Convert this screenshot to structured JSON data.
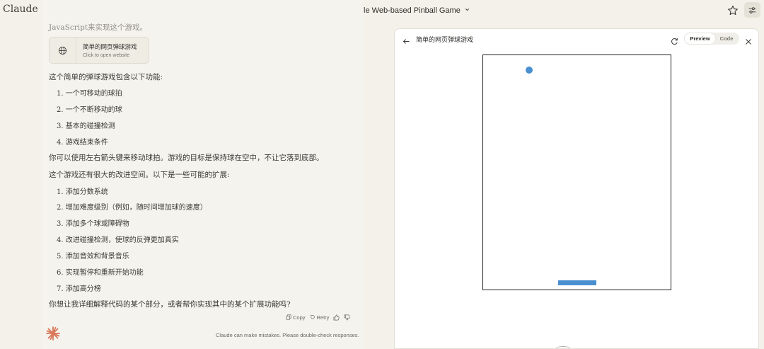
{
  "app": {
    "brand": "Claude"
  },
  "header": {
    "title": "Simple Web-based Pinball Game"
  },
  "chat": {
    "faded_line": "JavaScript来实现这个游戏。",
    "artifact_card": {
      "title": "简单的网页弹球游戏",
      "subtitle": "Click to open website"
    },
    "features_intro": "这个简单的弹球游戏包含以下功能:",
    "features": [
      "1. 一个可移动的球拍",
      "2. 一个不断移动的球",
      "3. 基本的碰撞检测",
      "4. 游戏结束条件"
    ],
    "controls_text": "你可以使用左右箭头键来移动球拍。游戏的目标是保持球在空中，不让它落到底部。",
    "extensions_intro": "这个游戏还有很大的改进空间。以下是一些可能的扩展:",
    "extensions": [
      "1. 添加分数系统",
      "2. 增加难度级别（例如，随时间增加球的速度）",
      "3. 添加多个球或障碍物",
      "4. 改进碰撞检测，使球的反弹更加真实",
      "5. 添加音效和背景音乐",
      "6. 实现暂停和重新开始功能",
      "7. 添加高分榜"
    ],
    "closing_question": "你想让我详细解释代码的某个部分，或者帮你实现其中的某个扩展功能吗?",
    "actions": {
      "copy": "Copy",
      "retry": "Retry"
    },
    "disclaimer": "Claude can make mistakes. Please double-check responses."
  },
  "panel": {
    "title": "简单的网页弹球游戏",
    "tabs": {
      "preview": "Preview",
      "code": "Code"
    }
  },
  "colors": {
    "ball": "#4a8fcf",
    "paddle": "#4a8fcf",
    "logo": "#d97757"
  }
}
